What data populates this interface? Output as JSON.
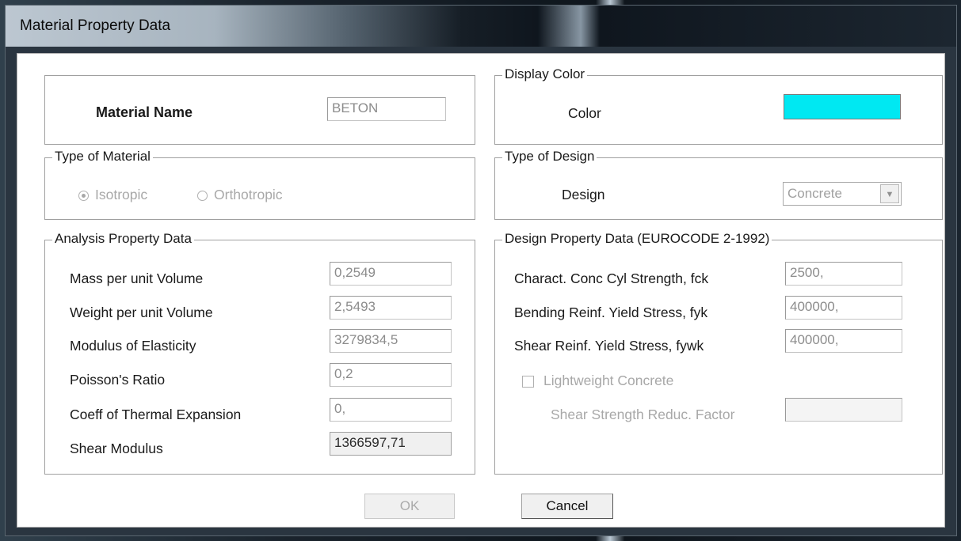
{
  "window": {
    "title": "Material Property Data"
  },
  "material": {
    "name_label": "Material Name",
    "name_value": "BETON"
  },
  "display_color": {
    "group_label": "Display Color",
    "color_label": "Color",
    "swatch_color": "#00e8f2"
  },
  "type_of_material": {
    "group_label": "Type of Material",
    "isotropic": "Isotropic",
    "orthotropic": "Orthotropic",
    "selected": "Isotropic"
  },
  "type_of_design": {
    "group_label": "Type of Design",
    "design_label": "Design",
    "design_value": "Concrete",
    "dropdown_icon": "chevron-down-icon"
  },
  "analysis": {
    "group_label": "Analysis Property Data",
    "rows": [
      {
        "label": "Mass per unit Volume",
        "value": "0,2549"
      },
      {
        "label": "Weight per unit Volume",
        "value": "2,5493"
      },
      {
        "label": "Modulus of Elasticity",
        "value": "3279834,5"
      },
      {
        "label": "Poisson's Ratio",
        "value": "0,2"
      },
      {
        "label": "Coeff of Thermal Expansion",
        "value": "0,"
      },
      {
        "label": "Shear Modulus",
        "value": "1366597,71"
      }
    ]
  },
  "design_props": {
    "group_label": "Design Property Data (EUROCODE 2-1992)",
    "rows": [
      {
        "label": "Charact. Conc Cyl Strength, fck",
        "value": "2500,"
      },
      {
        "label": "Bending Reinf. Yield Stress, fyk",
        "value": "400000,"
      },
      {
        "label": "Shear Reinf. Yield Stress, fywk",
        "value": "400000,"
      }
    ],
    "lightweight_label": "Lightweight Concrete",
    "lightweight_checked": false,
    "shear_factor_label": "Shear Strength Reduc. Factor",
    "shear_factor_value": ""
  },
  "buttons": {
    "ok": "OK",
    "cancel": "Cancel"
  }
}
